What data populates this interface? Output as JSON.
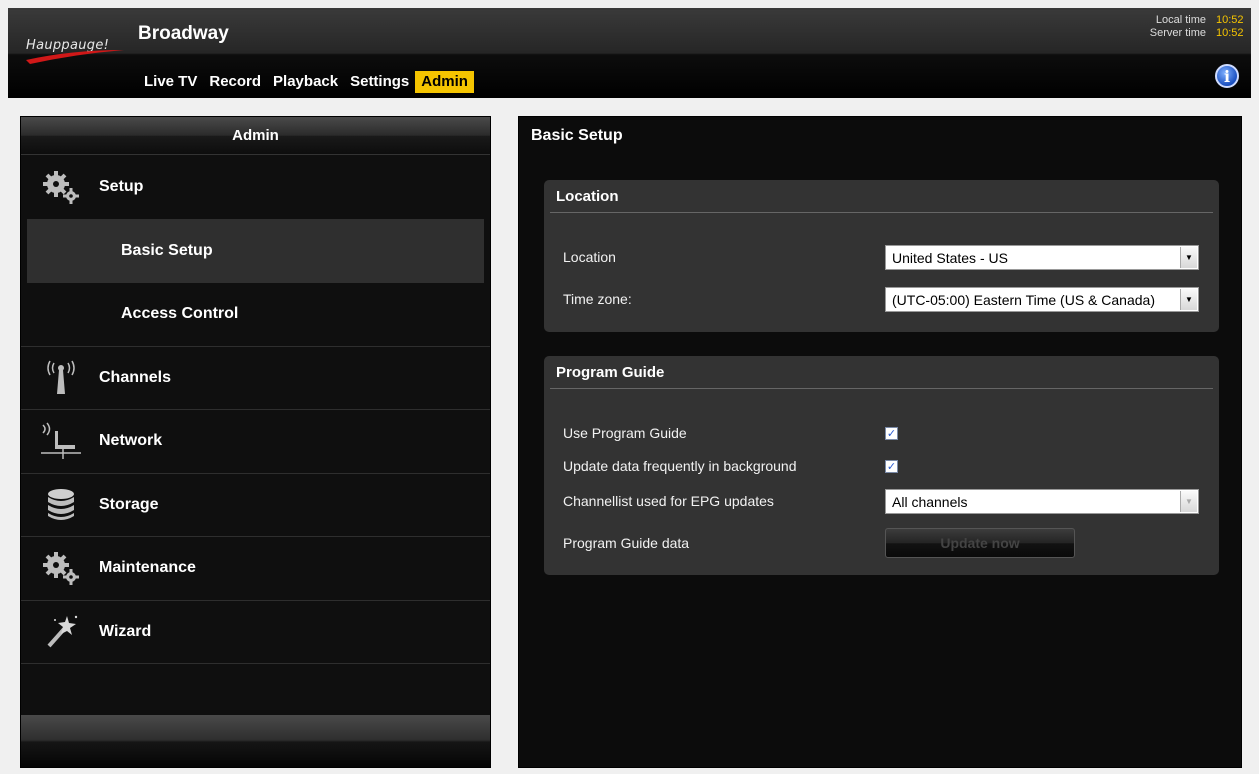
{
  "header": {
    "logo": "Hauppauge!",
    "app_title": "Broadway",
    "nav": [
      "Live TV",
      "Record",
      "Playback",
      "Settings",
      "Admin"
    ],
    "active_nav": "Admin",
    "local_time_label": "Local time",
    "local_time": "10:52",
    "server_time_label": "Server time",
    "server_time": "10:52",
    "accent_color": "#f5c400"
  },
  "sidebar": {
    "title": "Admin",
    "items": [
      {
        "label": "Setup",
        "icon": "gears-icon"
      },
      {
        "label": "Basic Setup",
        "sub": true,
        "selected": true
      },
      {
        "label": "Access Control",
        "sub": true
      },
      {
        "label": "Channels",
        "icon": "antenna-icon"
      },
      {
        "label": "Network",
        "icon": "network-icon"
      },
      {
        "label": "Storage",
        "icon": "database-icon"
      },
      {
        "label": "Maintenance",
        "icon": "gears-icon"
      },
      {
        "label": "Wizard",
        "icon": "magic-wand-icon"
      }
    ]
  },
  "main": {
    "title": "Basic Setup",
    "location_section": {
      "title": "Location",
      "location_label": "Location",
      "location_value": "United States - US",
      "timezone_label": "Time zone:",
      "timezone_value": "(UTC-05:00) Eastern Time (US & Canada)"
    },
    "guide_section": {
      "title": "Program Guide",
      "use_guide_label": "Use Program Guide",
      "use_guide_checked": true,
      "update_bg_label": "Update data frequently in background",
      "update_bg_checked": true,
      "channellist_label": "Channellist used for EPG updates",
      "channellist_value": "All channels",
      "guide_data_label": "Program Guide data",
      "update_button": "Update now"
    }
  }
}
